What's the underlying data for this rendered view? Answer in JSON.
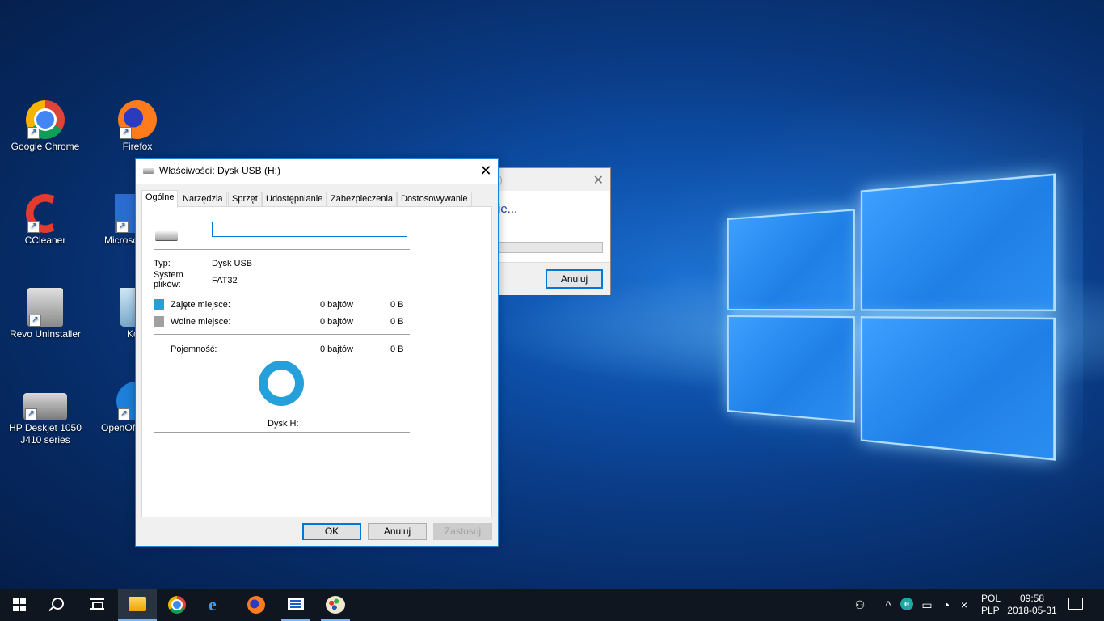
{
  "desktop": {
    "icons": [
      {
        "label": "Google Chrome",
        "icon": "chrome-icon"
      },
      {
        "label": "Firefox",
        "icon": "firefox-icon"
      },
      {
        "label": "CCleaner",
        "icon": "ccleaner-icon"
      },
      {
        "label": "Microso",
        "icon": "word-icon"
      },
      {
        "label": "Revo Uninstaller",
        "icon": "revo-uninstaller-icon"
      },
      {
        "label": "Ko",
        "icon": "recycle-bin-icon"
      },
      {
        "label": "HP Deskjet 1050 J410 series",
        "icon": "printer-icon"
      },
      {
        "label": "OpenOf",
        "icon": "openoffice-icon"
      }
    ]
  },
  "back_dialog": {
    "title_fragment": ")",
    "status_fragment": "ie...",
    "cancel_label": "Anuluj",
    "progress_percent": 0
  },
  "dialog": {
    "title": "Właściwości: Dysk USB (H:)",
    "close_label": "✕",
    "tabs": [
      {
        "label": "Ogólne",
        "active": true
      },
      {
        "label": "Narzędzia",
        "active": false
      },
      {
        "label": "Sprzęt",
        "active": false
      },
      {
        "label": "Udostępnianie",
        "active": false
      },
      {
        "label": "Zabezpieczenia",
        "active": false
      },
      {
        "label": "Dostosowywanie",
        "active": false
      }
    ],
    "name_value": "",
    "type_label": "Typ:",
    "type_value": "Dysk USB",
    "fs_label_1": "System",
    "fs_label_2": "plików:",
    "fs_value": "FAT32",
    "used": {
      "label": "Zajęte miejsce:",
      "bytes": "0 bajtów",
      "size": "0 B",
      "color": "#26a0da"
    },
    "free": {
      "label": "Wolne miejsce:",
      "bytes": "0 bajtów",
      "size": "0 B",
      "color": "#a0a0a0"
    },
    "capacity": {
      "label": "Pojemność:",
      "bytes": "0 bajtów",
      "size": "0 B"
    },
    "drive_caption": "Dysk H:",
    "buttons": {
      "ok": "OK",
      "cancel": "Anuluj",
      "apply": "Zastosuj"
    }
  },
  "taskbar": {
    "pinned": [
      "start-icon",
      "search-icon",
      "task-view-icon",
      "file-explorer-icon",
      "chrome-icon",
      "edge-icon",
      "firefox-icon",
      "list-app-icon",
      "paint-icon"
    ],
    "tray_icons": [
      "people-icon",
      "chevron-up-icon",
      "eset-icon",
      "wifi-icon",
      "battery-icon",
      "network-icon",
      "volume-muted-icon"
    ],
    "lang_top": "POL",
    "lang_bottom": "PLP",
    "time": "09:58",
    "date": "2018-05-31"
  }
}
